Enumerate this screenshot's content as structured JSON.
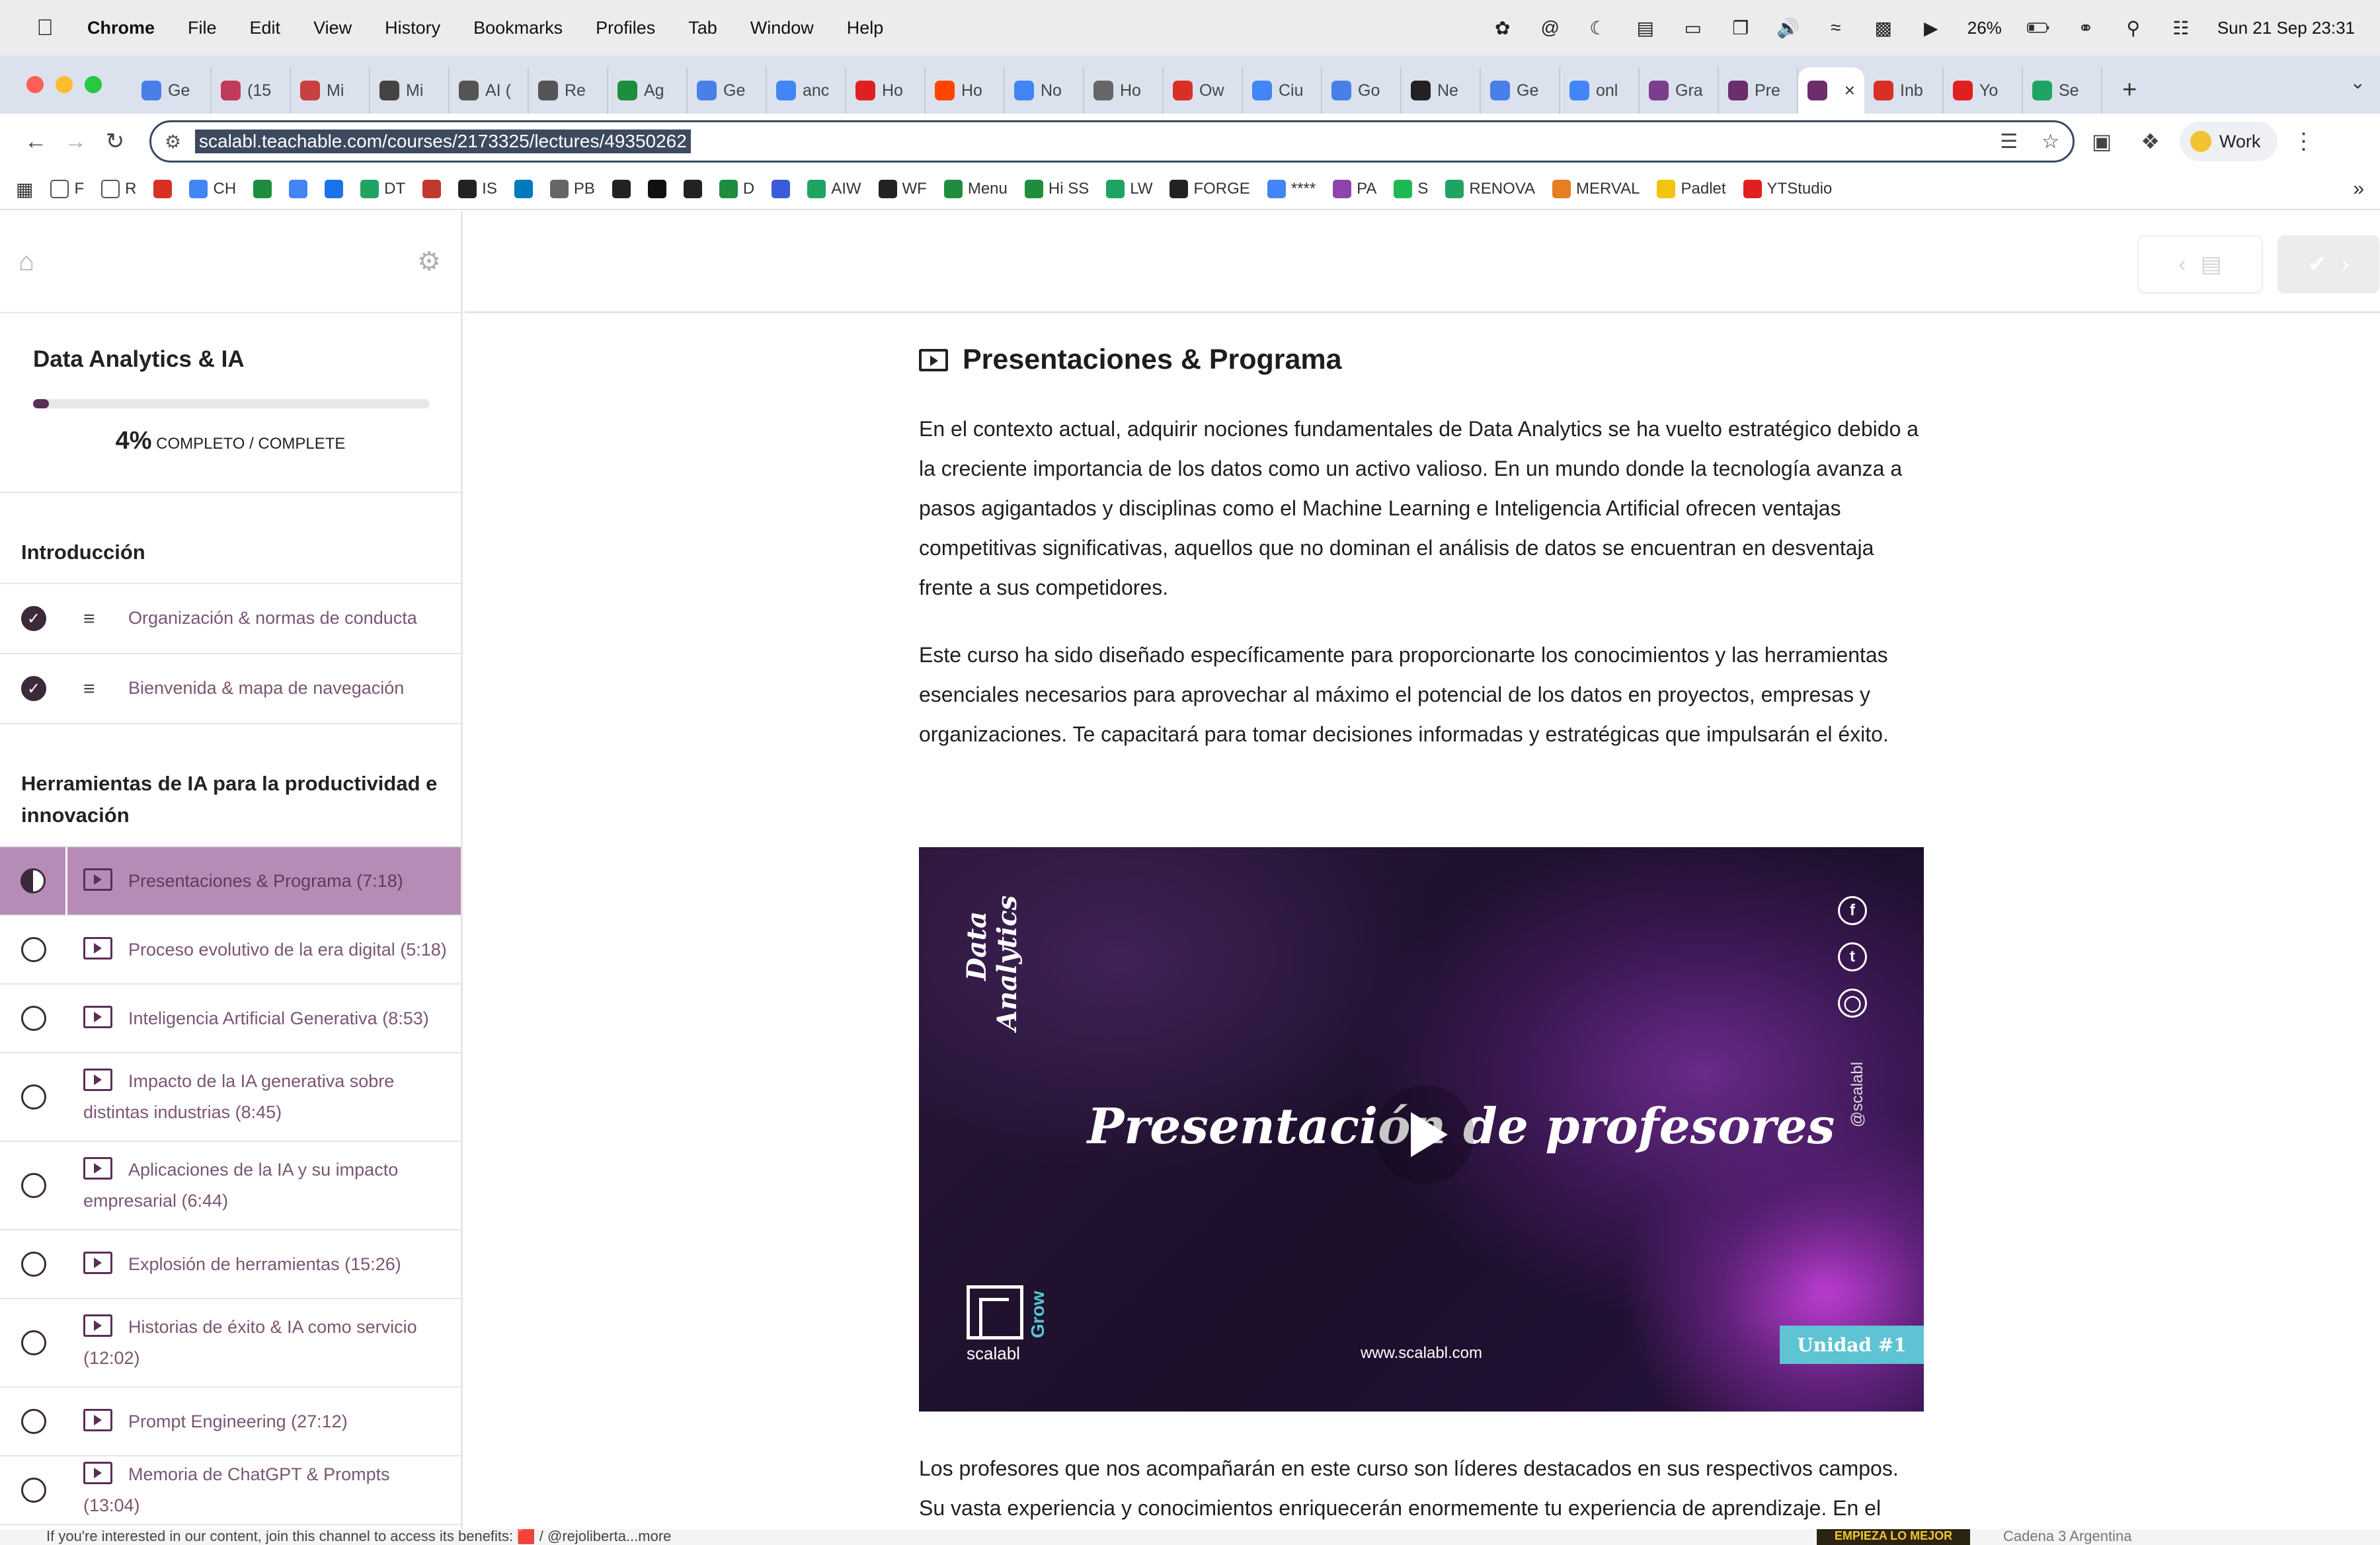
{
  "menubar": {
    "apple": "",
    "app_name": "Chrome",
    "menus": [
      "File",
      "Edit",
      "View",
      "History",
      "Bookmarks",
      "Profiles",
      "Tab",
      "Window",
      "Help"
    ],
    "status_icons": [
      "openai-icon",
      "threads-icon",
      "moon-icon",
      "sidebar-icon",
      "display-icon",
      "window-icon",
      "volume-icon",
      "activity-icon",
      "card-icon",
      "play-circle-icon"
    ],
    "battery": "26%",
    "datetime": "Sun 21 Sep  23:31"
  },
  "tabs": [
    {
      "icon": "gemini",
      "label": "Ge",
      "color": "#4a7fe8"
    },
    {
      "icon": "badge",
      "label": "(15",
      "color": "#c23a5a"
    },
    {
      "icon": "target",
      "label": "Mi",
      "color": "#c84040"
    },
    {
      "icon": "notion",
      "label": "Mi",
      "color": "#444444"
    },
    {
      "icon": "globe",
      "label": "AI (",
      "color": "#555555"
    },
    {
      "icon": "globe",
      "label": "Re",
      "color": "#555555"
    },
    {
      "icon": "sheets",
      "label": "Ag",
      "color": "#1e8e3e"
    },
    {
      "icon": "gemini",
      "label": "Ge",
      "color": "#4a7fe8"
    },
    {
      "icon": "google",
      "label": "anc",
      "color": "#4285f4"
    },
    {
      "icon": "youtube",
      "label": "Ho",
      "color": "#e02020"
    },
    {
      "icon": "reddit",
      "label": "Ho",
      "color": "#ff4500"
    },
    {
      "icon": "google",
      "label": "No",
      "color": "#4285f4"
    },
    {
      "icon": "apple",
      "label": "Ho",
      "color": "#666666"
    },
    {
      "icon": "gmail",
      "label": "Ow",
      "color": "#d93025"
    },
    {
      "icon": "globe",
      "label": "Ciu",
      "color": "#4285f4"
    },
    {
      "icon": "gemini",
      "label": "Go",
      "color": "#4a7fe8"
    },
    {
      "icon": "openai",
      "label": "Ne",
      "color": "#222222"
    },
    {
      "icon": "gemini",
      "label": "Ge",
      "color": "#4a7fe8"
    },
    {
      "icon": "google",
      "label": "onl",
      "color": "#4285f4"
    },
    {
      "icon": "grid",
      "label": "Gra",
      "color": "#7a3e8c"
    },
    {
      "icon": "teachable",
      "label": "Pre",
      "color": "#6b2d6b"
    },
    {
      "icon": "teachable",
      "label": "",
      "color": "#6b2d6b",
      "active": true
    },
    {
      "icon": "gmail",
      "label": "Inb",
      "color": "#d93025"
    },
    {
      "icon": "youtube",
      "label": "Yo",
      "color": "#e02020"
    },
    {
      "icon": "drive",
      "label": "Se",
      "color": "#1fa463"
    }
  ],
  "toolbar": {
    "url": "scalabl.teachable.com/courses/2173325/lectures/49350262",
    "profile_label": "Work"
  },
  "bookmarks": [
    {
      "icon": "folder",
      "label": "F",
      "color": "#555555"
    },
    {
      "icon": "folder",
      "label": "R",
      "color": "#555555"
    },
    {
      "icon": "gmail",
      "label": "",
      "color": "#d93025"
    },
    {
      "icon": "docs",
      "label": "CH",
      "color": "#4285f4"
    },
    {
      "icon": "s",
      "label": "",
      "color": "#1e8e3e"
    },
    {
      "icon": "calendar",
      "label": "",
      "color": "#4285f4"
    },
    {
      "icon": "chat",
      "label": "",
      "color": "#1a73e8"
    },
    {
      "icon": "drive",
      "label": "DT",
      "color": "#1fa463"
    },
    {
      "icon": "gear",
      "label": "",
      "color": "#c0392b"
    },
    {
      "icon": "is",
      "label": "IS",
      "color": "#222222"
    },
    {
      "icon": "trello",
      "label": "",
      "color": "#0079bf"
    },
    {
      "icon": "pb",
      "label": "PB",
      "color": "#666666"
    },
    {
      "icon": "openai",
      "label": "",
      "color": "#222222"
    },
    {
      "icon": "square",
      "label": "",
      "color": "#111111"
    },
    {
      "icon": "codepen",
      "label": "",
      "color": "#222222"
    },
    {
      "icon": "sheets",
      "label": "D",
      "color": "#1e8e3e"
    },
    {
      "icon": "d",
      "label": "",
      "color": "#3b5bdb"
    },
    {
      "icon": "drive",
      "label": "AIW",
      "color": "#1fa463"
    },
    {
      "icon": "wf",
      "label": "WF",
      "color": "#222222"
    },
    {
      "icon": "sheets",
      "label": "Menu",
      "color": "#1e8e3e"
    },
    {
      "icon": "sheets",
      "label": "Hi SS",
      "color": "#1e8e3e"
    },
    {
      "icon": "drive",
      "label": "LW",
      "color": "#1fa463"
    },
    {
      "icon": "notion",
      "label": "FORGE",
      "color": "#222222"
    },
    {
      "icon": "docs",
      "label": "****",
      "color": "#4285f4"
    },
    {
      "icon": "heart",
      "label": "PA",
      "color": "#8e44ad"
    },
    {
      "icon": "spotify",
      "label": "S",
      "color": "#1db954"
    },
    {
      "icon": "drive",
      "label": "RENOVA",
      "color": "#1fa463"
    },
    {
      "icon": "chart",
      "label": "MERVAL",
      "color": "#e67e22"
    },
    {
      "icon": "bulb",
      "label": "Padlet",
      "color": "#f1c40f"
    },
    {
      "icon": "youtube",
      "label": "YTStudio",
      "color": "#e02020"
    }
  ],
  "sidebar": {
    "course_title": "Data Analytics & IA",
    "progress": 0.04,
    "progress_pct": "4%",
    "progress_label": "COMPLETO / COMPLETE",
    "sections": [
      {
        "title": "Introducción",
        "lectures": [
          {
            "title": "Organización & normas de conducta",
            "type": "text",
            "status": "done"
          },
          {
            "title": "Bienvenida & mapa de navegación",
            "type": "text",
            "status": "done"
          }
        ]
      },
      {
        "title": "Herramientas de IA para la productividad e innovación",
        "lectures": [
          {
            "title": "Presentaciones & Programa (7:18)",
            "type": "video",
            "status": "current"
          },
          {
            "title": "Proceso evolutivo de la era digital (5:18)",
            "type": "video",
            "status": "todo"
          },
          {
            "title": "Inteligencia Artificial Generativa (8:53)",
            "type": "video",
            "status": "todo"
          },
          {
            "title": "Impacto de la IA generativa sobre distintas industrias (8:45)",
            "type": "video",
            "status": "todo"
          },
          {
            "title": "Aplicaciones de la IA y su impacto empresarial (6:44)",
            "type": "video",
            "status": "todo"
          },
          {
            "title": "Explosión de herramientas (15:26)",
            "type": "video",
            "status": "todo"
          },
          {
            "title": "Historias de éxito & IA como servicio (12:02)",
            "type": "video",
            "status": "todo"
          },
          {
            "title": "Prompt Engineering (27:12)",
            "type": "video",
            "status": "todo"
          },
          {
            "title": "Memoria de ChatGPT & Prompts (13:04)",
            "type": "video",
            "status": "todo"
          }
        ]
      }
    ]
  },
  "main": {
    "lecture_title": "Presentaciones & Programa",
    "paragraph1": "En el contexto actual, adquirir nociones fundamentales de Data Analytics se ha vuelto estratégico debido a la creciente importancia de los datos como un activo valioso. En un mundo donde la tecnología avanza a pasos agigantados y disciplinas como el Machine Learning e Inteligencia Artificial ofrecen ventajas competitivas significativas, aquellos que no dominan el análisis de datos se encuentran en desventaja frente a sus competidores.",
    "paragraph2": "Este curso ha sido diseñado específicamente para proporcionarte los conocimientos y las herramientas esenciales necesarios para aprovechar al máximo el potencial de los datos en proyectos, empresas y organizaciones. Te capacitará para tomar decisiones informadas y estratégicas que impulsarán el éxito.",
    "video": {
      "brand_line1": "Data",
      "brand_line2": "Analytics",
      "title": "Presentación de profesores",
      "handle": "@scalabl",
      "logo_name": "scalabl",
      "logo_tag": "Grow",
      "url": "www.scalabl.com",
      "unit": "Unidad #1",
      "socials": [
        "facebook-icon",
        "twitter-icon",
        "instagram-icon"
      ]
    },
    "paragraph3": "Los profesores que nos acompañarán en este curso son líderes destacados en sus respectivos campos. Su vasta experiencia y conocimientos enriquecerán enormemente tu experiencia de aprendizaje. En el video"
  },
  "bottom_strip": {
    "text": "If you're interested in our content, join this channel to access its benefits: 🟥 / @rejoliberta...more",
    "thumb": "EMPIEZA LO MEJOR",
    "right": "Cadena 3 Argentina"
  }
}
